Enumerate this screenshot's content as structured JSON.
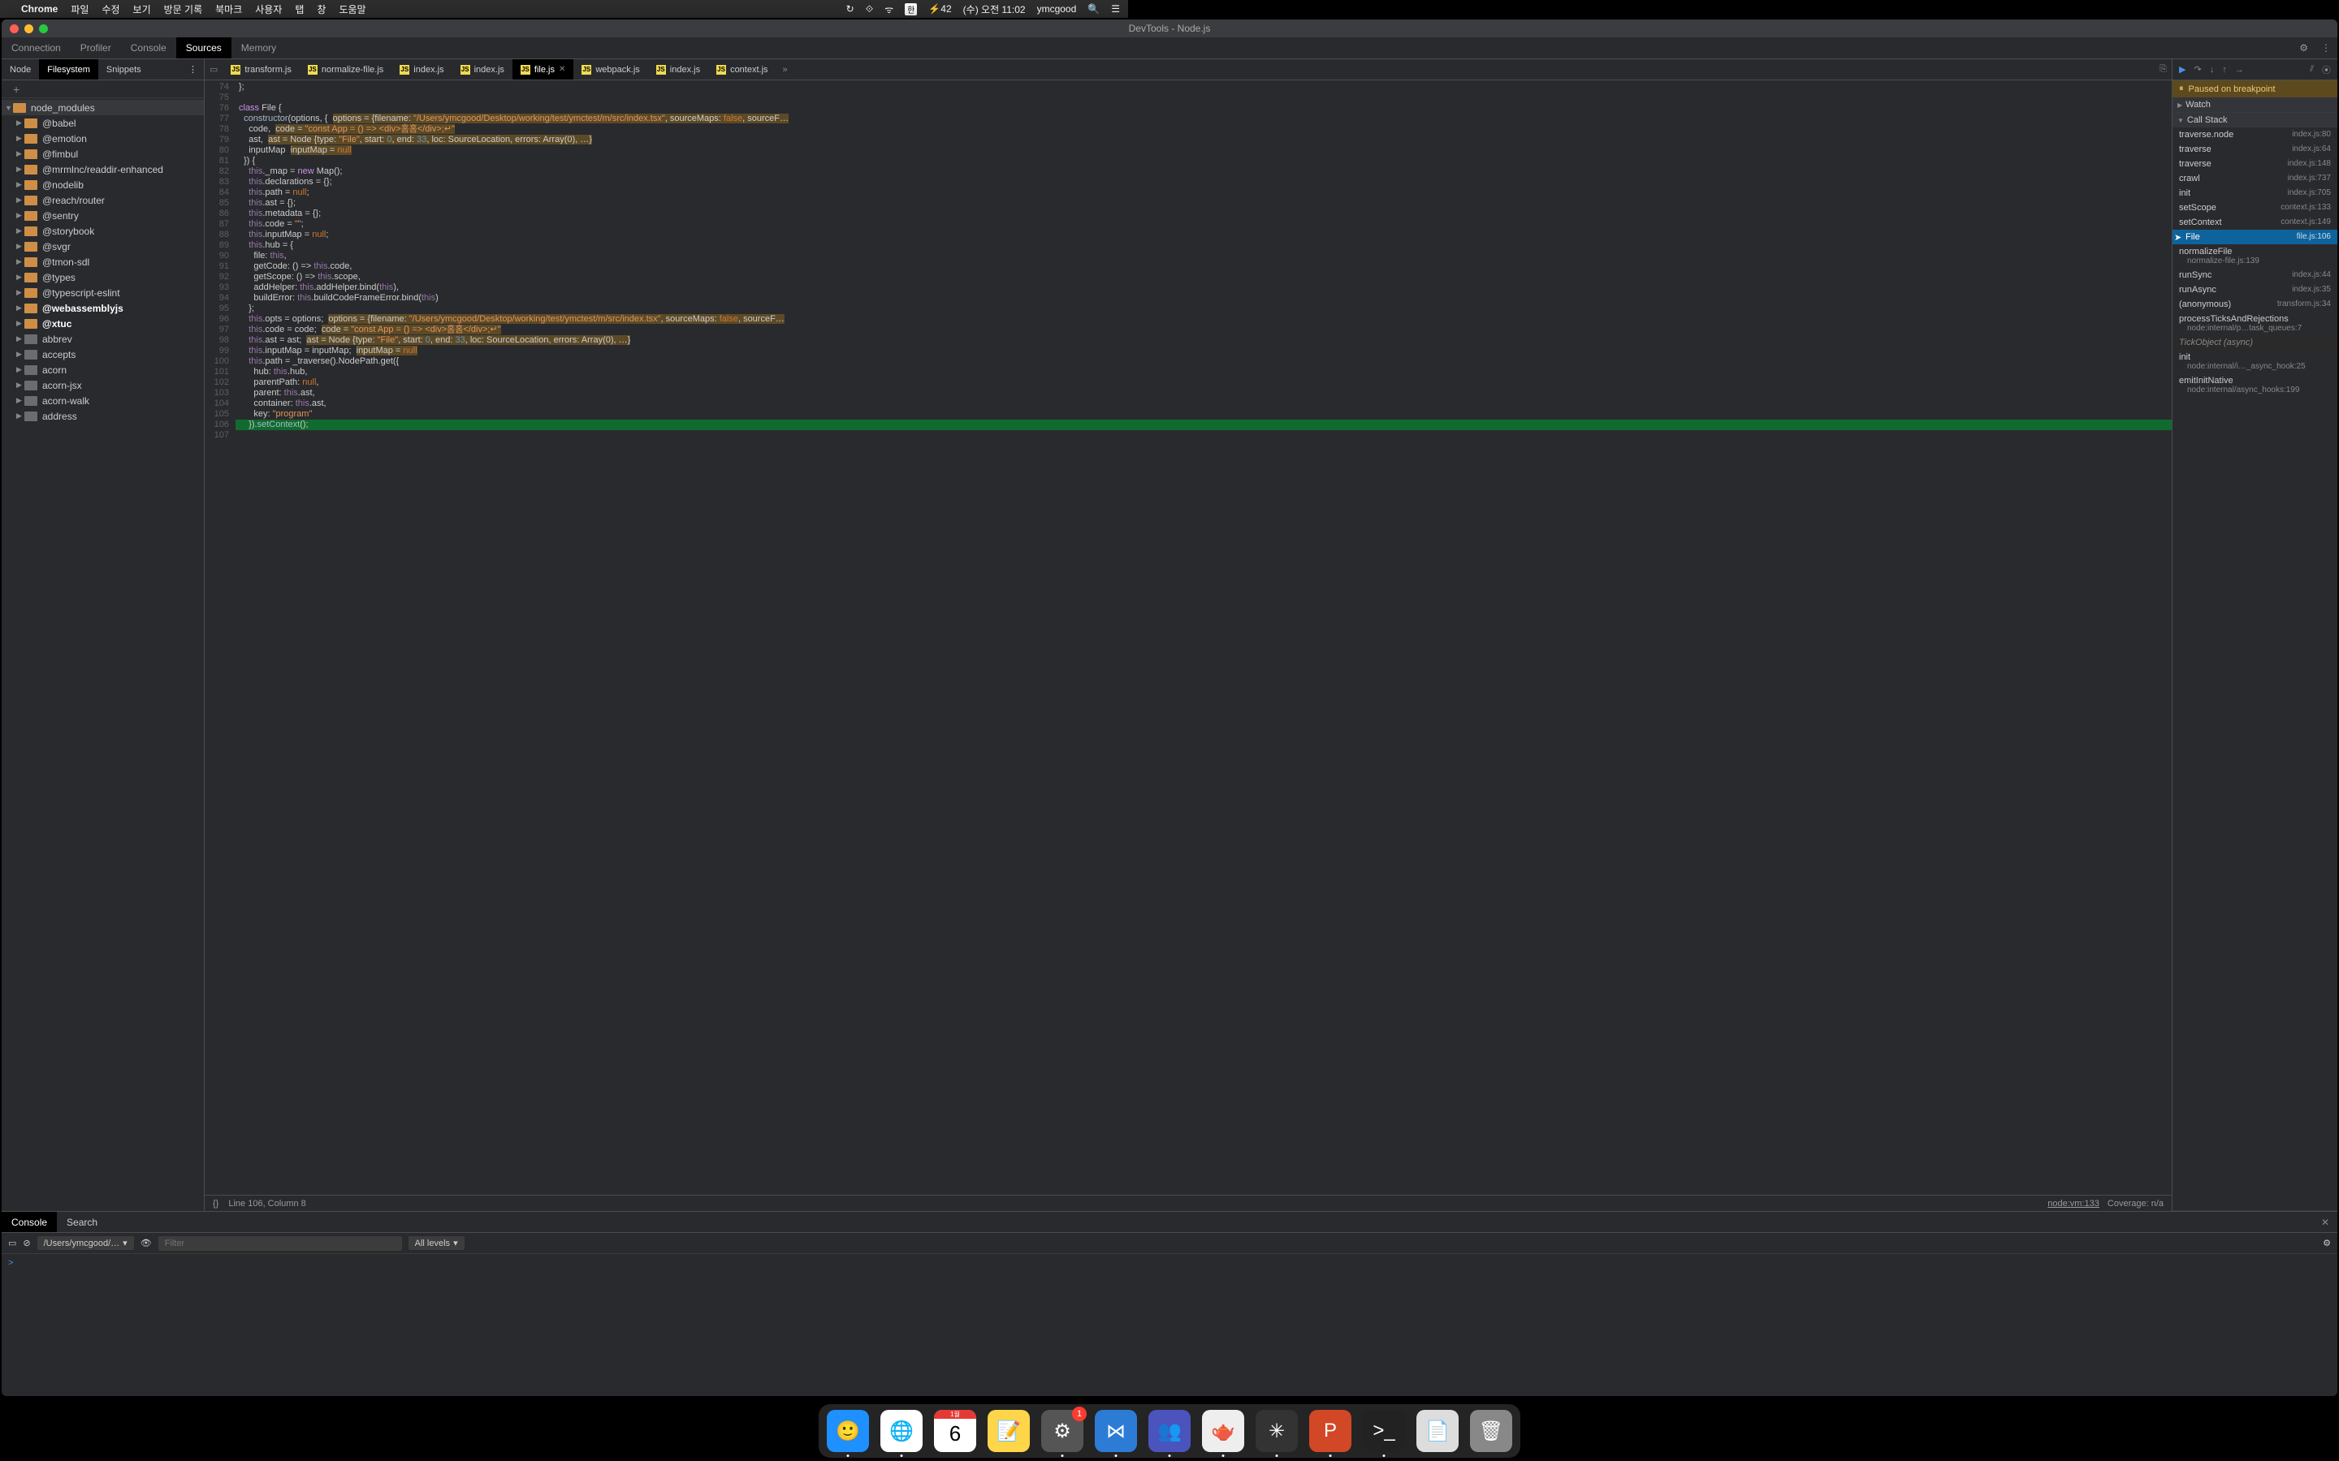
{
  "menubar": {
    "app": "Chrome",
    "items": [
      "파일",
      "수정",
      "보기",
      "방문 기록",
      "북마크",
      "사용자",
      "탭",
      "창",
      "도움말"
    ],
    "right": {
      "ime": "한",
      "battery": "⚡42",
      "date": "(수) 오전 11:02",
      "user": "ymcgood"
    }
  },
  "window": {
    "title": "DevTools - Node.js"
  },
  "devtools_tabs": [
    "Connection",
    "Profiler",
    "Console",
    "Sources",
    "Memory"
  ],
  "devtools_active": "Sources",
  "left_tabs": [
    "Node",
    "Filesystem",
    "Snippets"
  ],
  "left_active": "Filesystem",
  "tree_root": "node_modules",
  "tree_items": [
    {
      "name": "@babel",
      "color": "orange"
    },
    {
      "name": "@emotion",
      "color": "orange"
    },
    {
      "name": "@fimbul",
      "color": "orange"
    },
    {
      "name": "@mrmlnc/readdir-enhanced",
      "color": "orange"
    },
    {
      "name": "@nodelib",
      "color": "orange"
    },
    {
      "name": "@reach/router",
      "color": "orange"
    },
    {
      "name": "@sentry",
      "color": "orange"
    },
    {
      "name": "@storybook",
      "color": "orange"
    },
    {
      "name": "@svgr",
      "color": "orange"
    },
    {
      "name": "@tmon-sdl",
      "color": "orange"
    },
    {
      "name": "@types",
      "color": "orange"
    },
    {
      "name": "@typescript-eslint",
      "color": "orange"
    },
    {
      "name": "@webassemblyjs",
      "color": "orange",
      "bold": true
    },
    {
      "name": "@xtuc",
      "color": "orange",
      "bold": true
    },
    {
      "name": "abbrev",
      "color": "gray"
    },
    {
      "name": "accepts",
      "color": "gray"
    },
    {
      "name": "acorn",
      "color": "gray"
    },
    {
      "name": "acorn-jsx",
      "color": "gray"
    },
    {
      "name": "acorn-walk",
      "color": "gray"
    },
    {
      "name": "address",
      "color": "gray"
    }
  ],
  "file_tabs": [
    {
      "name": "transform.js"
    },
    {
      "name": "normalize-file.js"
    },
    {
      "name": "index.js"
    },
    {
      "name": "index.js"
    },
    {
      "name": "file.js",
      "active": true,
      "closable": true
    },
    {
      "name": "webpack.js"
    },
    {
      "name": "index.js"
    },
    {
      "name": "context.js"
    }
  ],
  "gutter_start": 74,
  "gutter_end": 107,
  "status": {
    "pos": "Line 106, Column 8",
    "src": "node:vm:133",
    "cov": "Coverage: n/a"
  },
  "paused_msg": "Paused on breakpoint",
  "right_sections": {
    "watch": "Watch",
    "callstack": "Call Stack"
  },
  "call_stack": [
    {
      "fn": "traverse.node",
      "loc": "index.js:80"
    },
    {
      "fn": "traverse",
      "loc": "index.js:64"
    },
    {
      "fn": "traverse",
      "loc": "index.js:148"
    },
    {
      "fn": "crawl",
      "loc": "index.js:737"
    },
    {
      "fn": "init",
      "loc": "index.js:705"
    },
    {
      "fn": "setScope",
      "loc": "context.js:133"
    },
    {
      "fn": "setContext",
      "loc": "context.js:149"
    },
    {
      "fn": "File",
      "loc": "file.js:106",
      "sel": true
    },
    {
      "fn": "normalizeFile",
      "loc": "normalize-file.js:139",
      "wrap": true
    },
    {
      "fn": "runSync",
      "loc": "index.js:44"
    },
    {
      "fn": "runAsync",
      "loc": "index.js:35"
    },
    {
      "fn": "(anonymous)",
      "loc": "transform.js:34"
    },
    {
      "fn": "processTicksAndRejections",
      "loc": "node:internal/p…task_queues:7",
      "wrap": true
    },
    {
      "async": "TickObject (async)"
    },
    {
      "fn": "init",
      "loc": "node:internal/i…_async_hook:25",
      "wrap": true
    },
    {
      "fn": "emitInitNative",
      "loc": "node:internal/async_hooks:199",
      "wrap": true
    }
  ],
  "console": {
    "tabs": [
      "Console",
      "Search"
    ],
    "active": "Console",
    "context": "/Users/ymcgood/…",
    "filter_ph": "Filter",
    "levels": "All levels",
    "prompt": ">"
  },
  "dock": [
    {
      "name": "finder",
      "bg": "#1e90ff",
      "glyph": "🙂",
      "running": true
    },
    {
      "name": "chrome",
      "bg": "#fff",
      "glyph": "🌐",
      "running": true
    },
    {
      "name": "calendar",
      "bg": "#fff",
      "glyph": "6",
      "sub": "1월"
    },
    {
      "name": "notes",
      "bg": "#ffd54a",
      "glyph": "📝"
    },
    {
      "name": "settings",
      "bg": "#555",
      "glyph": "⚙",
      "badge": "1",
      "running": true
    },
    {
      "name": "vscode",
      "bg": "#2c7cd6",
      "glyph": "⋈",
      "running": true
    },
    {
      "name": "teams",
      "bg": "#4b53bc",
      "glyph": "👥",
      "running": true
    },
    {
      "name": "pitcher",
      "bg": "#eee",
      "glyph": "🫖",
      "running": true
    },
    {
      "name": "charles",
      "bg": "#333",
      "glyph": "✳",
      "running": true
    },
    {
      "name": "powerpoint",
      "bg": "#d24726",
      "glyph": "P",
      "running": true
    },
    {
      "name": "terminal",
      "bg": "#222",
      "glyph": ">_",
      "running": true
    },
    {
      "name": "doc",
      "bg": "#ddd",
      "glyph": "📄"
    },
    {
      "name": "trash",
      "bg": "#888",
      "glyph": "🗑"
    }
  ]
}
